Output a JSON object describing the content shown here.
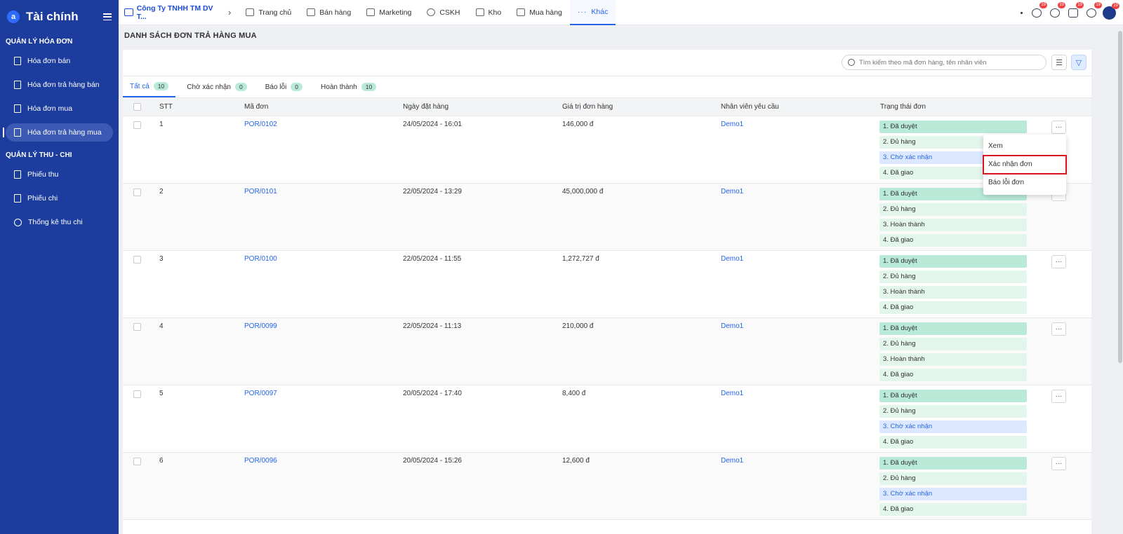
{
  "sidebar": {
    "logo": "a",
    "title": "Tài chính",
    "section1": "QUẢN LÝ HÓA ĐƠN",
    "section2": "QUẢN LÝ THU - CHI",
    "items1": [
      "Hóa đơn bán",
      "Hóa đơn trả hàng bán",
      "Hóa đơn mua",
      "Hóa đơn trả hàng mua"
    ],
    "items2": [
      "Phiếu thu",
      "Phiếu chi",
      "Thống kê thu chi"
    ]
  },
  "topbar": {
    "company": "Công Ty TNHH TM DV T...",
    "nav": [
      "Trang chủ",
      "Bán hàng",
      "Marketing",
      "CSKH",
      "Kho",
      "Mua hàng",
      "Khác"
    ],
    "badge": "19"
  },
  "page": {
    "title": "DANH SÁCH ĐƠN TRẢ HÀNG MUA"
  },
  "search": {
    "placeholder": "Tìm kiếm theo mã đơn hàng, tên nhân viên"
  },
  "tabs": [
    {
      "label": "Tất cả",
      "count": "10"
    },
    {
      "label": "Chờ xác nhận",
      "count": "0"
    },
    {
      "label": "Báo lỗi",
      "count": "0"
    },
    {
      "label": "Hoàn thành",
      "count": "10"
    }
  ],
  "table": {
    "headers": [
      "STT",
      "Mã đơn",
      "Ngày đặt hàng",
      "Giá trị đơn hàng",
      "Nhân viên yêu cầu",
      "Trạng thái đơn"
    ],
    "rows": [
      {
        "stt": "1",
        "code": "POR/0102",
        "date": "24/05/2024 - 16:01",
        "value": "146,000 đ",
        "emp": "Demo1",
        "status": [
          "1. Đã duyệt",
          "2. Đủ hàng",
          "3. Chờ xác nhận",
          "4. Đã giao"
        ]
      },
      {
        "stt": "2",
        "code": "POR/0101",
        "date": "22/05/2024 - 13:29",
        "value": "45,000,000 đ",
        "emp": "Demo1",
        "status": [
          "1. Đã duyệt",
          "2. Đủ hàng",
          "3. Hoàn thành",
          "4. Đã giao"
        ]
      },
      {
        "stt": "3",
        "code": "POR/0100",
        "date": "22/05/2024 - 11:55",
        "value": "1,272,727 đ",
        "emp": "Demo1",
        "status": [
          "1. Đã duyệt",
          "2. Đủ hàng",
          "3. Hoàn thành",
          "4. Đã giao"
        ]
      },
      {
        "stt": "4",
        "code": "POR/0099",
        "date": "22/05/2024 - 11:13",
        "value": "210,000 đ",
        "emp": "Demo1",
        "status": [
          "1. Đã duyệt",
          "2. Đủ hàng",
          "3. Hoàn thành",
          "4. Đã giao"
        ]
      },
      {
        "stt": "5",
        "code": "POR/0097",
        "date": "20/05/2024 - 17:40",
        "value": "8,400 đ",
        "emp": "Demo1",
        "status": [
          "1. Đã duyệt",
          "2. Đủ hàng",
          "3. Chờ xác nhận",
          "4. Đã giao"
        ]
      },
      {
        "stt": "6",
        "code": "POR/0096",
        "date": "20/05/2024 - 15:26",
        "value": "12,600 đ",
        "emp": "Demo1",
        "status": [
          "1. Đã duyệt",
          "2. Đủ hàng",
          "3. Chờ xác nhận",
          "4. Đã giao"
        ]
      }
    ]
  },
  "menu": {
    "items": [
      "Xem",
      "Xác nhận đơn",
      "Báo lỗi đơn"
    ]
  },
  "colors": {
    "sidebar": "#1d3d9e",
    "accent": "#2563eb",
    "status_green": "#b8ead7",
    "status_blue": "#dce8ff",
    "highlight": "#d9141e"
  }
}
